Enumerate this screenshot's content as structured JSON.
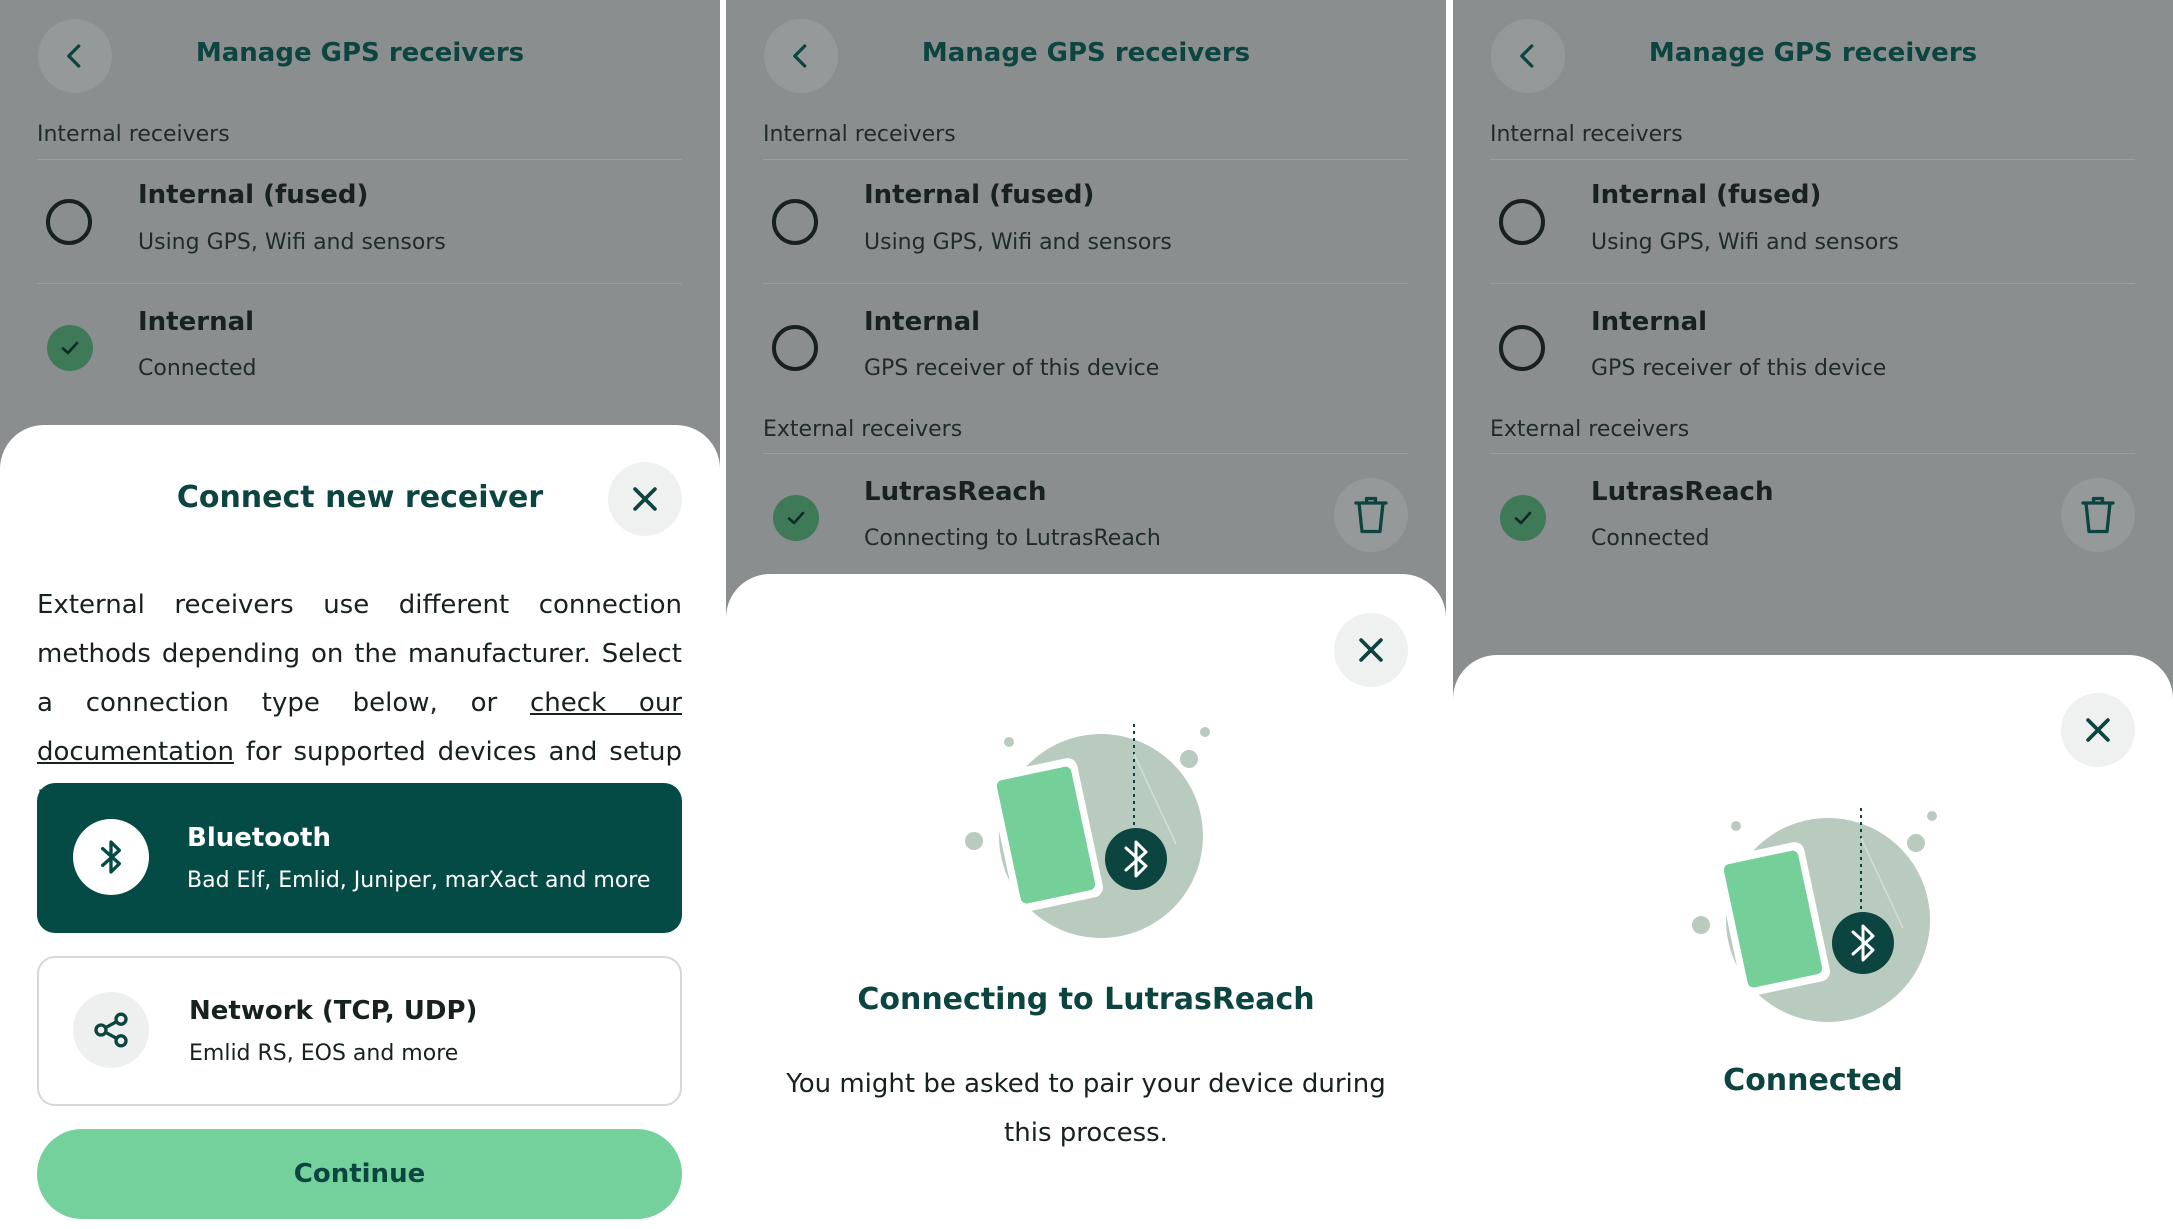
{
  "colors": {
    "overlay_bg": "#8a8e8f",
    "brand_dark": "#0c4440",
    "selected_option": "#044b45",
    "continue_bg": "#74d19b",
    "check_green": "#3e7a58",
    "phone_green": "#75cf98",
    "illustration_circle": "#b9cbbf"
  },
  "icons": {
    "back": "chevron-left-icon",
    "check": "check-icon",
    "trash": "trash-icon",
    "close": "close-icon",
    "bluetooth": "bluetooth-icon",
    "network": "share-network-icon"
  },
  "panels": [
    {
      "header": {
        "title": "Manage GPS receivers"
      },
      "internal_label": "Internal receivers",
      "receivers": [
        {
          "title": "Internal (fused)",
          "subtitle": "Using GPS, Wifi and sensors",
          "state": "unselected"
        },
        {
          "title": "Internal",
          "subtitle": "Connected",
          "state": "selected"
        }
      ],
      "sheet": {
        "title": "Connect new receiver",
        "text_before_link": "External receivers use different connection methods depending on the manufacturer. Select a connection type below, or ",
        "link_text": "check our documentation",
        "text_after_link": " for supported devices and setup instructions.",
        "options": [
          {
            "title": "Bluetooth",
            "subtitle": "Bad Elf, Emlid, Juniper, marXact and more",
            "selected": true
          },
          {
            "title": "Network (TCP, UDP)",
            "subtitle": "Emlid RS, EOS and more",
            "selected": false
          }
        ],
        "continue_label": "Continue"
      }
    },
    {
      "header": {
        "title": "Manage GPS receivers"
      },
      "internal_label": "Internal receivers",
      "receivers": [
        {
          "title": "Internal (fused)",
          "subtitle": "Using GPS, Wifi and sensors",
          "state": "unselected"
        },
        {
          "title": "Internal",
          "subtitle": "GPS receiver of this device",
          "state": "unselected"
        }
      ],
      "external_label": "External receivers",
      "external": {
        "title": "LutrasReach",
        "subtitle": "Connecting to LutrasReach",
        "state": "selected"
      },
      "sheet": {
        "title": "Connecting to LutrasReach",
        "body": "You might be asked to pair your device during this process."
      }
    },
    {
      "header": {
        "title": "Manage GPS receivers"
      },
      "internal_label": "Internal receivers",
      "receivers": [
        {
          "title": "Internal (fused)",
          "subtitle": "Using GPS, Wifi and sensors",
          "state": "unselected"
        },
        {
          "title": "Internal",
          "subtitle": "GPS receiver of this device",
          "state": "unselected"
        }
      ],
      "external_label": "External receivers",
      "external": {
        "title": "LutrasReach",
        "subtitle": "Connected",
        "state": "selected"
      },
      "sheet": {
        "title": "Connected"
      }
    }
  ]
}
